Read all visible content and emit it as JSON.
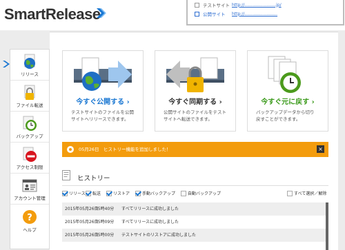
{
  "brand": {
    "logo_text": "SmartRelease"
  },
  "sites": [
    {
      "label": "テストサイト",
      "url": "http://........................jp/"
    },
    {
      "label": "公開サイト",
      "url": "http://........................."
    }
  ],
  "sidebar": {
    "items": [
      {
        "label": "リリース",
        "icon": "globe-icon"
      },
      {
        "label": "ファイル転送",
        "icon": "lock-icon"
      },
      {
        "label": "バックアップ",
        "icon": "clock-icon"
      },
      {
        "label": "アクセス制限",
        "icon": "no-entry-icon"
      },
      {
        "label": "アカウント管理",
        "icon": "account-icon"
      },
      {
        "label": "ヘルプ",
        "icon": "help-icon"
      }
    ]
  },
  "cards": [
    {
      "title": "今すぐ公開する ›",
      "desc1": "テストサイトのファイルを公開",
      "desc2": "サイトへリリースできます。",
      "color": "#1a77d2"
    },
    {
      "title": "今すぐ同期する ›",
      "desc1": "公開サイトのファイルをテスト",
      "desc2": "サイトへ転送できます。",
      "color": "#333333"
    },
    {
      "title": "今すぐ元に戻す ›",
      "desc1": "バックアップデータから切り",
      "desc2": "戻すことができます。",
      "color": "#3a9a1a"
    }
  ],
  "notification": {
    "text": "05月26日　ヒストリー機能を追加しました！",
    "close": "×",
    "color": "#f39c0d"
  },
  "history": {
    "title": "ヒストリー",
    "filters": [
      {
        "label": "リリース",
        "checked": true
      },
      {
        "label": "転送",
        "checked": true
      },
      {
        "label": "リストア",
        "checked": true
      },
      {
        "label": "手動バックアップ",
        "checked": true
      },
      {
        "label": "自動バックアップ",
        "checked": false
      }
    ],
    "select_all": "すべて選択／解除",
    "rows": [
      {
        "date": "2015年05月26日",
        "time": "15時40分",
        "message": "すべてリリースに成功しました"
      },
      {
        "date": "2015年05月26日",
        "time": "15時09分",
        "message": "すべてリリースに成功しました"
      },
      {
        "date": "2015年05月26日",
        "time": "15時00分",
        "message": "テストサイトのリストアに成功しました"
      }
    ]
  }
}
